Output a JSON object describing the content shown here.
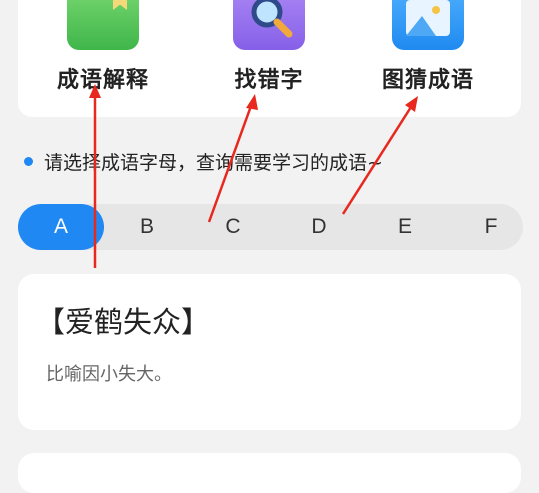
{
  "features": [
    {
      "label": "成语解释",
      "icon": "book-icon"
    },
    {
      "label": "找错字",
      "icon": "magnifier-icon"
    },
    {
      "label": "图猜成语",
      "icon": "image-icon"
    }
  ],
  "hint": "请选择成语字母，查询需要学习的成语~",
  "letters": [
    "A",
    "B",
    "C",
    "D",
    "E",
    "F"
  ],
  "active_letter": "A",
  "idiom": {
    "title": "【爱鹤失众】",
    "meaning": "比喻因小失大。"
  },
  "colors": {
    "accent": "#1f88f3",
    "annotation_arrow": "#e8281e"
  }
}
